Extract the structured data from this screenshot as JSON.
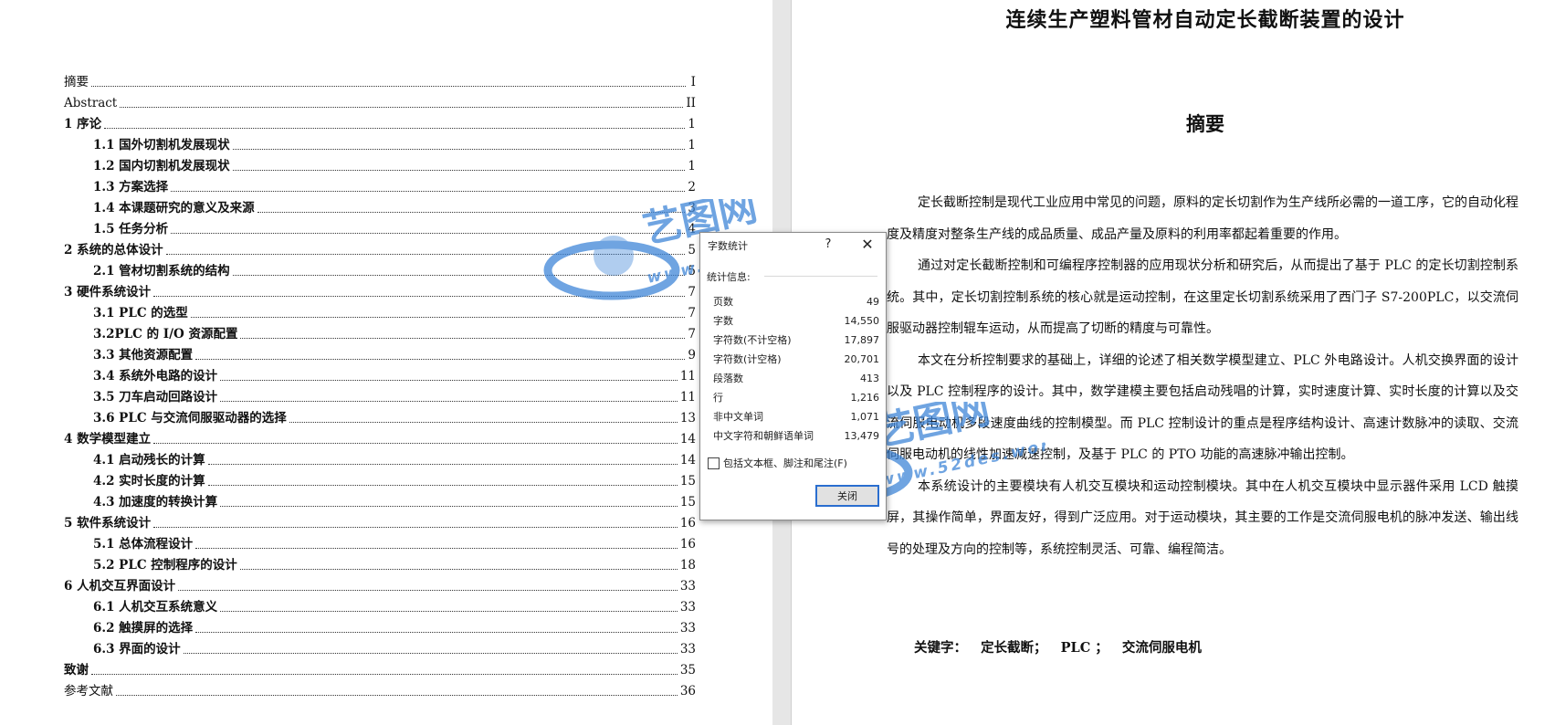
{
  "toc": [
    {
      "title": "摘要",
      "page": "I",
      "level": "plain"
    },
    {
      "title": "Abstract",
      "page": "II",
      "level": "plain"
    },
    {
      "title": "1 序论",
      "page": "1",
      "level": "l1"
    },
    {
      "title": "1.1 国外切割机发展现状",
      "page": "1",
      "level": "l2"
    },
    {
      "title": "1.2 国内切割机发展现状",
      "page": "1",
      "level": "l2"
    },
    {
      "title": "1.3 方案选择",
      "page": "2",
      "level": "l2"
    },
    {
      "title": "1.4 本课题研究的意义及来源",
      "page": "3",
      "level": "l2"
    },
    {
      "title": "1.5 任务分析",
      "page": "4",
      "level": "l2"
    },
    {
      "title": "2 系统的总体设计",
      "page": "5",
      "level": "l1"
    },
    {
      "title": "2.1 管材切割系统的结构",
      "page": "5",
      "level": "l2"
    },
    {
      "title": "3 硬件系统设计",
      "page": "7",
      "level": "l1"
    },
    {
      "title": "3.1 PLC 的选型",
      "page": "7",
      "level": "l2"
    },
    {
      "title": "3.2PLC 的 I/O 资源配置",
      "page": "7",
      "level": "l2"
    },
    {
      "title": "3.3 其他资源配置",
      "page": "9",
      "level": "l2"
    },
    {
      "title": "3.4 系统外电路的设计",
      "page": "11",
      "level": "l2"
    },
    {
      "title": "3.5 刀车启动回路设计",
      "page": "11",
      "level": "l2"
    },
    {
      "title": "3.6 PLC 与交流伺服驱动器的选择",
      "page": "13",
      "level": "l2"
    },
    {
      "title": "4 数学模型建立",
      "page": "14",
      "level": "l1"
    },
    {
      "title": "4.1 启动残长的计算",
      "page": "14",
      "level": "l2"
    },
    {
      "title": "4.2 实时长度的计算",
      "page": "15",
      "level": "l2"
    },
    {
      "title": "4.3 加速度的转换计算",
      "page": "15",
      "level": "l2"
    },
    {
      "title": "5 软件系统设计",
      "page": "16",
      "level": "l1"
    },
    {
      "title": "5.1 总体流程设计",
      "page": "16",
      "level": "l2"
    },
    {
      "title": "5.2 PLC 控制程序的设计",
      "page": "18",
      "level": "l2"
    },
    {
      "title": "6 人机交互界面设计",
      "page": "33",
      "level": "l1"
    },
    {
      "title": "6.1 人机交互系统意义",
      "page": "33",
      "level": "l2"
    },
    {
      "title": "6.2 触摸屏的选择",
      "page": "33",
      "level": "l2"
    },
    {
      "title": "6.3 界面的设计",
      "page": "33",
      "level": "l2"
    },
    {
      "title": "致谢",
      "page": "35",
      "level": "l1"
    },
    {
      "title": "参考文献",
      "page": "36",
      "level": "plain"
    }
  ],
  "document": {
    "title": "连续生产塑料管材自动定长截断装置的设计",
    "abstract_heading": "摘要",
    "paragraphs": [
      "定长截断控制是现代工业应用中常见的问题，原料的定长切割作为生产线所必需的一道工序，它的自动化程度及精度对整条生产线的成品质量、成品产量及原料的利用率都起着重要的作用。",
      "通过对定长截断控制和可编程序控制器的应用现状分析和研究后，从而提出了基于 PLC 的定长切割控制系统。其中，定长切割控制系统的核心就是运动控制，在这里定长切割系统采用了西门子 S7-200PLC，以交流伺服驱动器控制辊车运动，从而提高了切断的精度与可靠性。",
      "本文在分析控制要求的基础上，详细的论述了相关数学模型建立、PLC 外电路设计。人机交换界面的设计以及 PLC 控制程序的设计。其中，数学建模主要包括启动残唱的计算，实时速度计算、实时长度的计算以及交流伺服电动机多段速度曲线的控制模型。而 PLC 控制设计的重点是程序结构设计、高速计数脉冲的读取、交流伺服电动机的线性加速减速控制，及基于 PLC 的 PTO 功能的高速脉冲输出控制。",
      "本系统设计的主要模块有人机交互模块和运动控制模块。其中在人机交互模块中显示器件采用 LCD 触摸屏，其操作简单，界面友好，得到广泛应用。对于运动模块，其主要的工作是交流伺服电机的脉冲发送、输出线号的处理及方向的控制等，系统控制灵活、可靠、编程简洁。"
    ],
    "keywords_label": "关键字：",
    "keywords": [
      "定长截断；",
      "PLC ；",
      "交流伺服电机"
    ]
  },
  "word_count_dialog": {
    "title": "字数统计",
    "help_label": "?",
    "close_x": "✕",
    "section_label": "统计信息:",
    "stats": [
      {
        "label": "页数",
        "value": "49"
      },
      {
        "label": "字数",
        "value": "14,550"
      },
      {
        "label": "字符数(不计空格)",
        "value": "17,897"
      },
      {
        "label": "字符数(计空格)",
        "value": "20,701"
      },
      {
        "label": "段落数",
        "value": "413"
      },
      {
        "label": "行",
        "value": "1,216"
      },
      {
        "label": "非中文单词",
        "value": "1,071"
      },
      {
        "label": "中文字符和朝鲜语单词",
        "value": "13,479"
      }
    ],
    "checkbox_label": "包括文本框、脚注和尾注(F)",
    "checkbox_checked": false,
    "close_button": "关闭"
  },
  "watermark": {
    "brand": "艺图网",
    "url": "www.52des.work",
    "color": "#3f86d8"
  }
}
